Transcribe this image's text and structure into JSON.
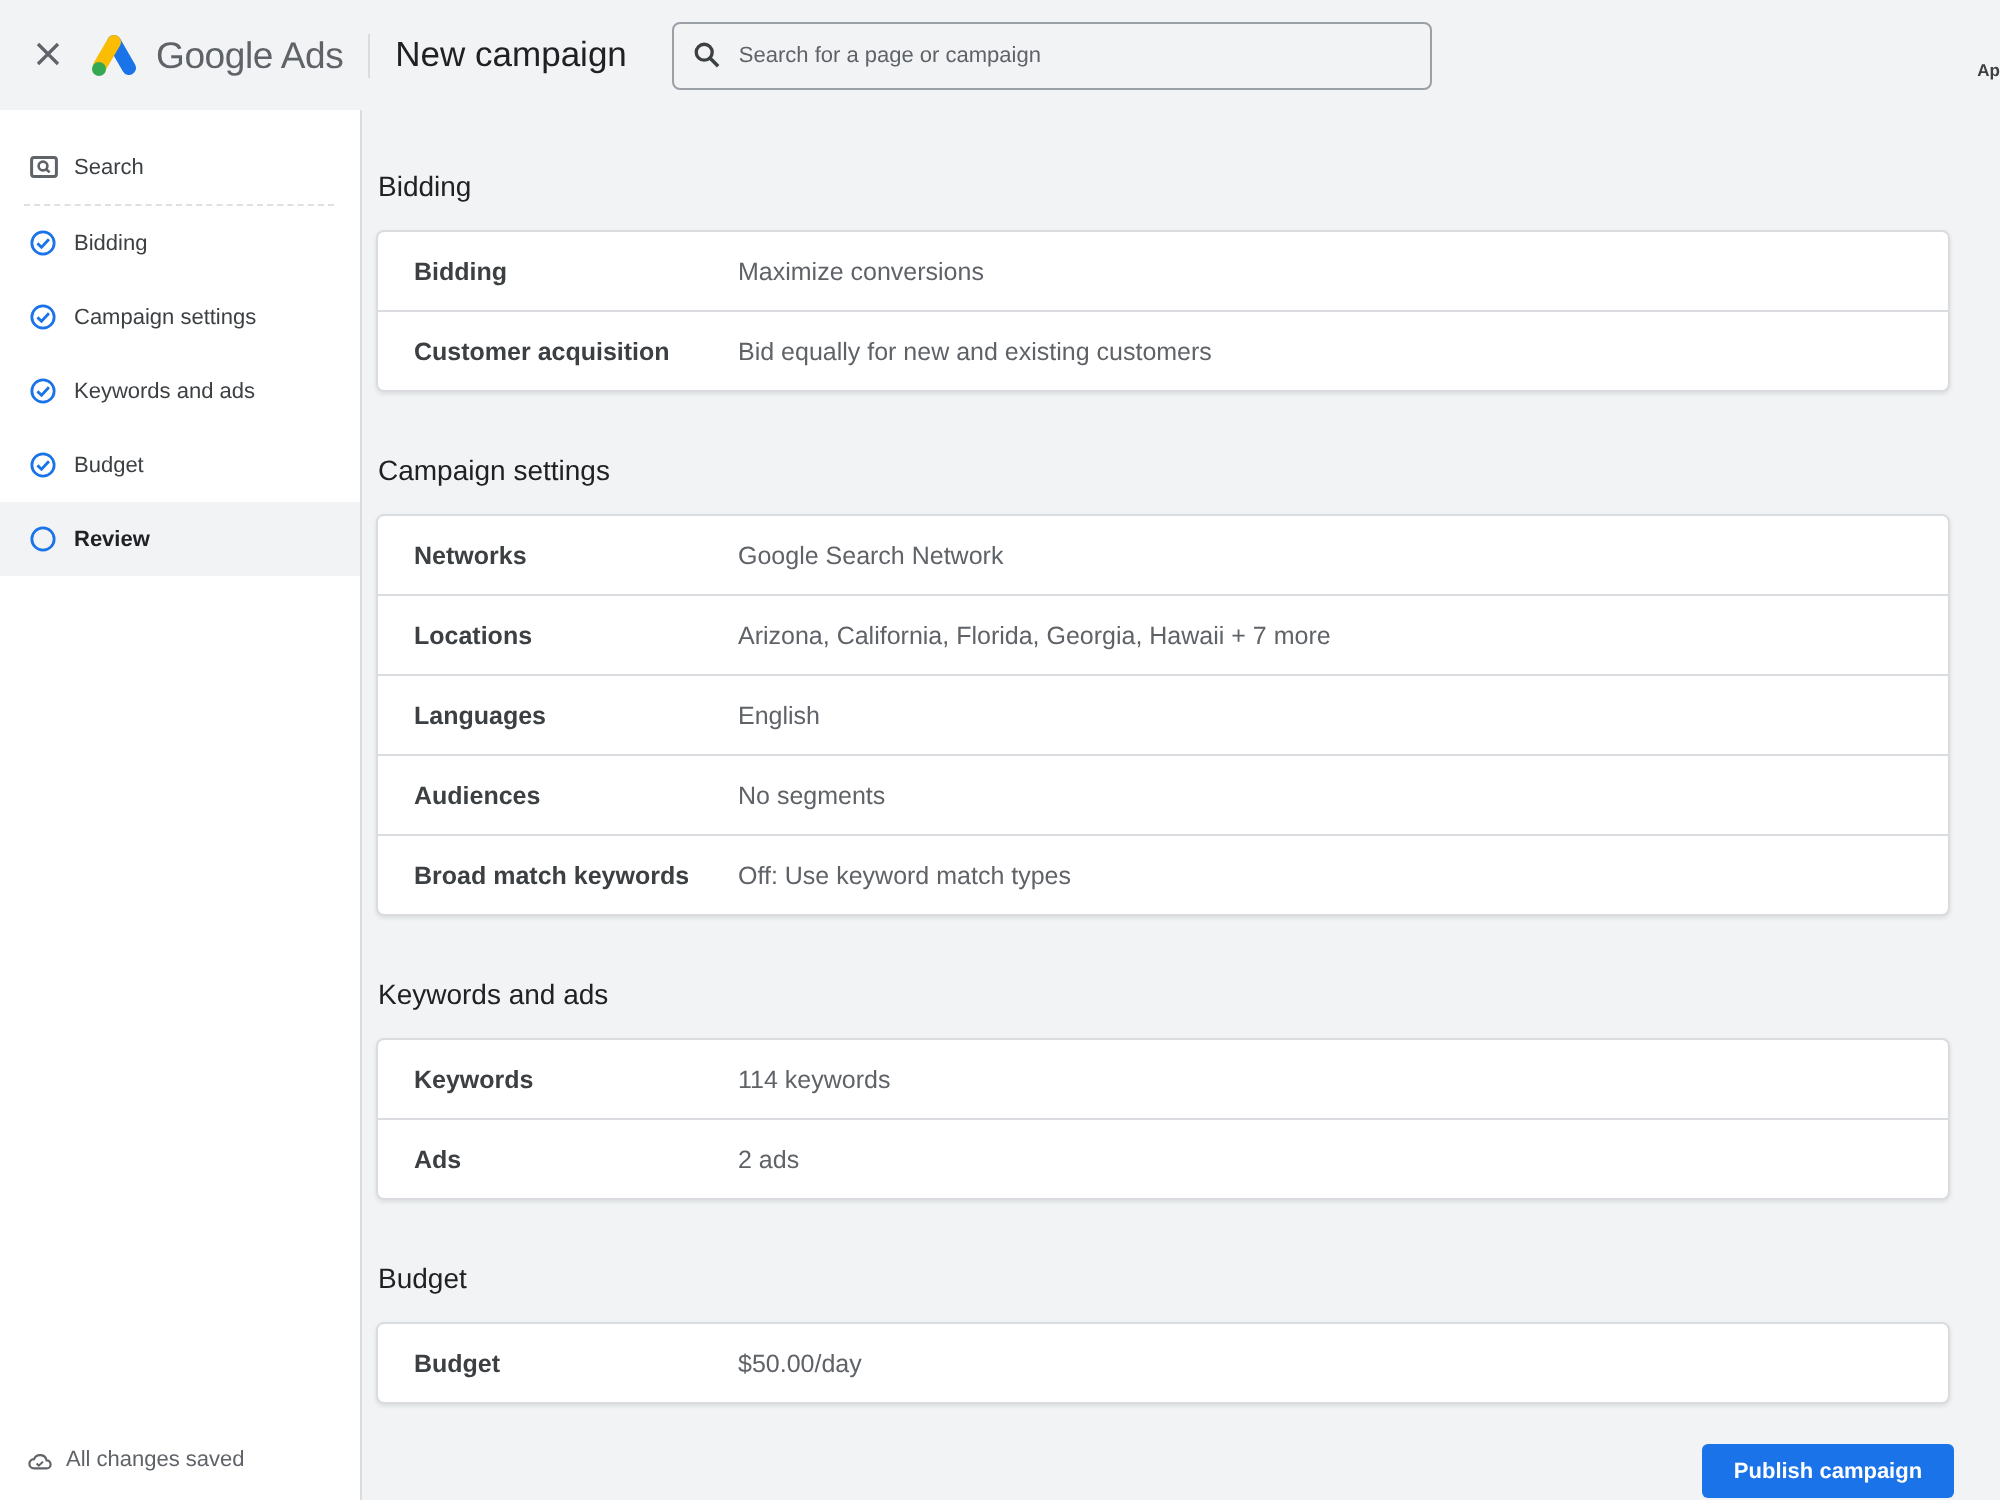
{
  "header": {
    "brand": "Google Ads",
    "page_title": "New campaign",
    "search": {
      "placeholder": "Search for a page or campaign"
    },
    "edge_text": "Ap"
  },
  "sidebar": {
    "items": [
      {
        "kind": "search",
        "label": "Search",
        "selected": false
      },
      {
        "kind": "step",
        "label": "Bidding",
        "completed": true,
        "selected": false
      },
      {
        "kind": "step",
        "label": "Campaign settings",
        "completed": true,
        "selected": false
      },
      {
        "kind": "step",
        "label": "Keywords and ads",
        "completed": true,
        "selected": false
      },
      {
        "kind": "step",
        "label": "Budget",
        "completed": true,
        "selected": false
      },
      {
        "kind": "step",
        "label": "Review",
        "completed": false,
        "selected": true
      }
    ],
    "footer": "All changes saved"
  },
  "sections": [
    {
      "title": "Bidding",
      "rows": [
        {
          "label": "Bidding",
          "value": "Maximize conversions"
        },
        {
          "label": "Customer acquisition",
          "value": "Bid equally for new and existing customers"
        }
      ]
    },
    {
      "title": "Campaign settings",
      "rows": [
        {
          "label": "Networks",
          "value": "Google Search Network"
        },
        {
          "label": "Locations",
          "value": "Arizona, California, Florida, Georgia, Hawaii + 7 more"
        },
        {
          "label": "Languages",
          "value": "English"
        },
        {
          "label": "Audiences",
          "value": "No segments"
        },
        {
          "label": "Broad match keywords",
          "value": "Off: Use keyword match types"
        }
      ]
    },
    {
      "title": "Keywords and ads",
      "rows": [
        {
          "label": "Keywords",
          "value": "114 keywords"
        },
        {
          "label": "Ads",
          "value": "2 ads"
        }
      ]
    },
    {
      "title": "Budget",
      "rows": [
        {
          "label": "Budget",
          "value": "$50.00/day"
        }
      ]
    }
  ],
  "publish_button": "Publish campaign"
}
